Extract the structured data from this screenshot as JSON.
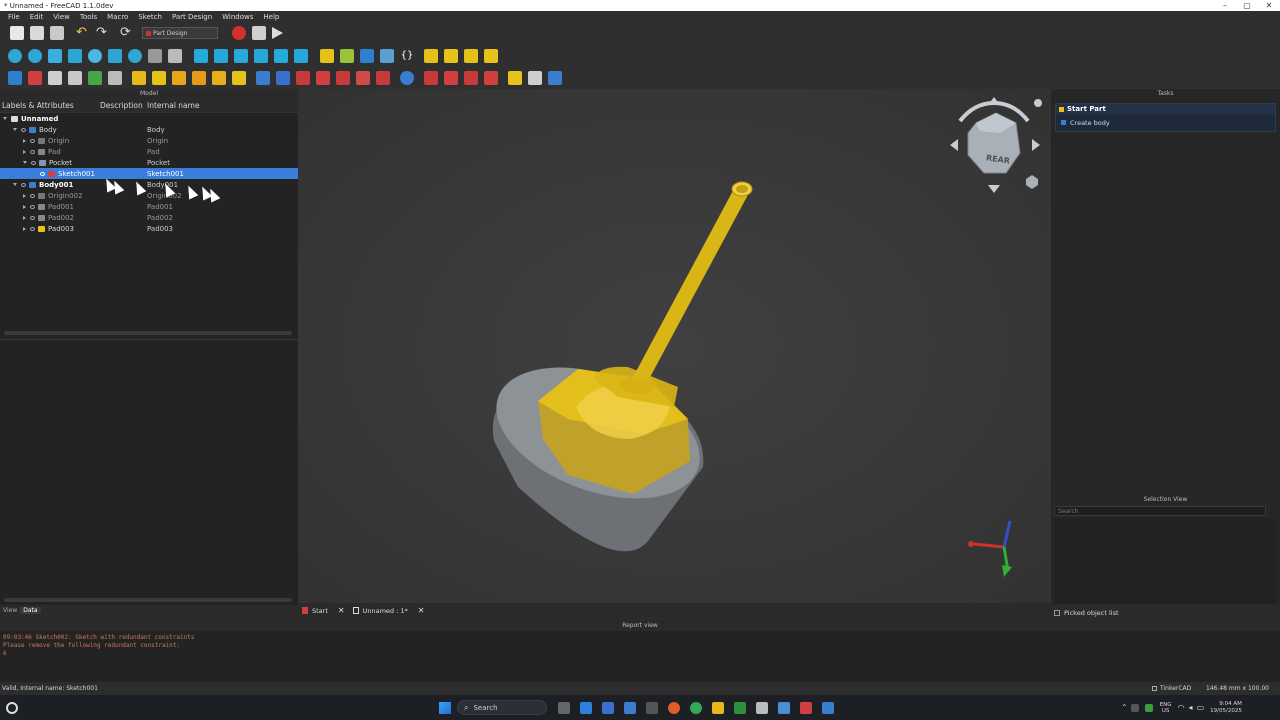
{
  "window": {
    "title": "* Unnamed - FreeCAD 1.1.0dev"
  },
  "menu": [
    "File",
    "Edit",
    "View",
    "Tools",
    "Macro",
    "Sketch",
    "Part Design",
    "Windows",
    "Help"
  ],
  "toolbar": {
    "workbench": "Part Design"
  },
  "model_panel": {
    "title": "Model",
    "columns": [
      "Labels & Attributes",
      "Description",
      "Internal name"
    ],
    "tree": [
      {
        "label": "Unnamed",
        "internal": "",
        "level": 0,
        "bold": true,
        "expanded": true
      },
      {
        "label": "Body",
        "internal": "Body",
        "level": 1,
        "expanded": true
      },
      {
        "label": "Origin",
        "internal": "Origin",
        "level": 2,
        "dim": true
      },
      {
        "label": "Pad",
        "internal": "Pad",
        "level": 2,
        "dim": true
      },
      {
        "label": "Pocket",
        "internal": "Pocket",
        "level": 2,
        "expanded": true
      },
      {
        "label": "Sketch001",
        "internal": "Sketch001",
        "level": 3,
        "selected": true
      },
      {
        "label": "Body001",
        "internal": "Body001",
        "level": 1,
        "bold": true,
        "expanded": true
      },
      {
        "label": "Origin002",
        "internal": "Origin002",
        "level": 2,
        "dim": true
      },
      {
        "label": "Pad001",
        "internal": "Pad001",
        "level": 2,
        "dim": true
      },
      {
        "label": "Pad002",
        "internal": "Pad002",
        "level": 2,
        "dim": true
      },
      {
        "label": "Pad003",
        "internal": "Pad003",
        "level": 2
      }
    ],
    "bottom_tabs": [
      "View",
      "Data"
    ]
  },
  "navcube": {
    "face": "REAR"
  },
  "tasks_panel": {
    "title": "Tasks",
    "section": "Start Part",
    "action": "Create body"
  },
  "selection_panel": {
    "title": "Selection View",
    "search_placeholder": "Search",
    "picked_label": "Picked object list"
  },
  "doc_tabs": [
    {
      "label": "Start"
    },
    {
      "label": "Unnamed : 1*"
    }
  ],
  "report": {
    "title": "Report view",
    "lines": [
      "09:03:46  Sketch002: Sketch with redundant constraints",
      "Please remove the following redundant constraint:",
      "6"
    ]
  },
  "status": {
    "left": "Valid, Internal name: Sketch001",
    "nav": "TinkerCAD",
    "dims": "146.48 mm x 100.00 mm"
  },
  "taskbar": {
    "search": "Search",
    "lang": "ENG",
    "region": "US",
    "time": "9:04 AM",
    "date": "19/05/2025"
  },
  "colors": {
    "selection": "#3b7ddd",
    "yellow_part": "#e6c21a",
    "grey_part": "#8a8f95"
  }
}
